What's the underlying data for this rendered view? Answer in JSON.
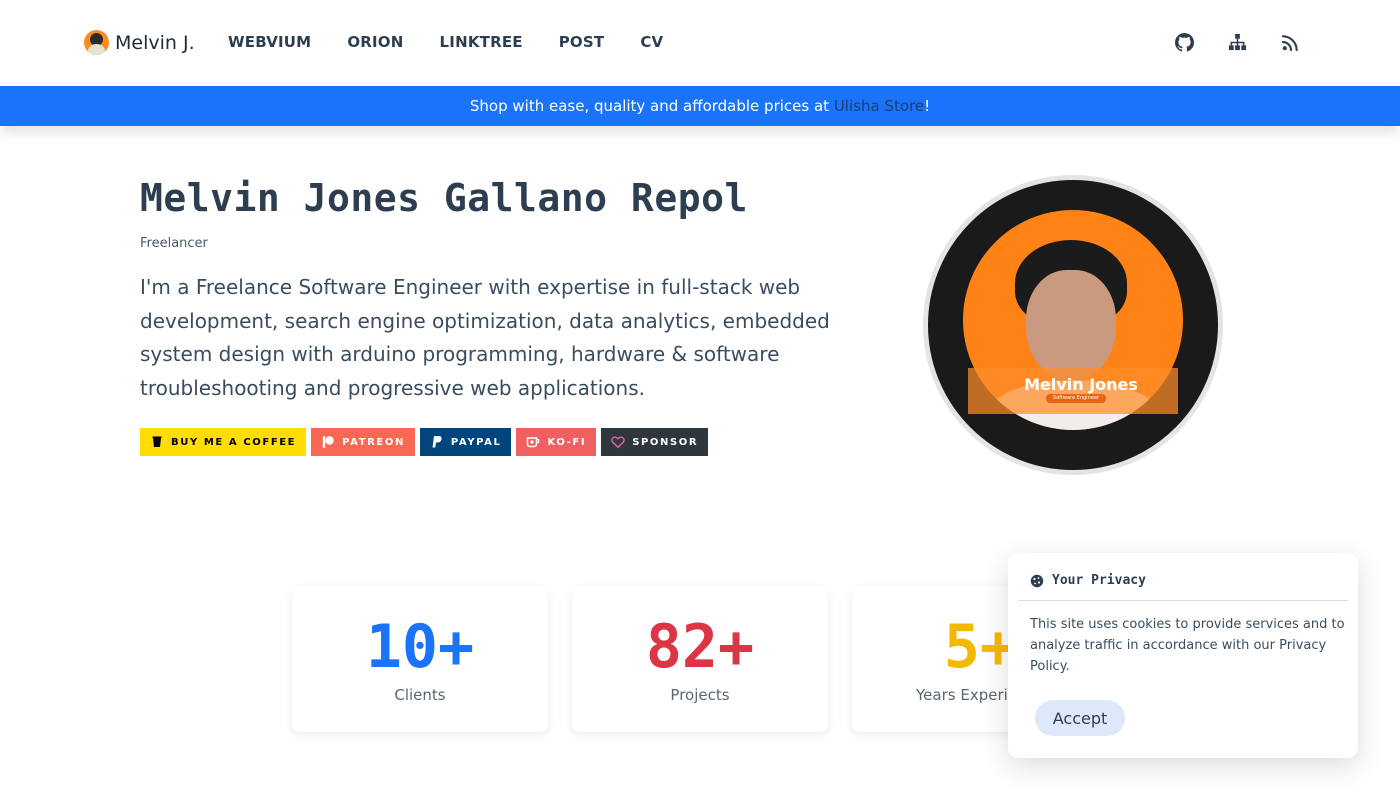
{
  "nav": {
    "brand": "Melvin J.",
    "links": [
      "WEBVIUM",
      "ORION",
      "LINKTREE",
      "POST",
      "CV"
    ],
    "icons": [
      "github-icon",
      "sitemap-icon",
      "rss-icon"
    ]
  },
  "banner": {
    "prefix": "Shop with ease, quality and affordable prices at ",
    "link": "Ulisha Store",
    "suffix": "!"
  },
  "hero": {
    "name": "Melvin Jones Gallano Repol",
    "role": "Freelancer",
    "description": "I'm a Freelance Software Engineer with expertise in full-stack web development, search engine optimization, data analytics, embedded system design with arduino programming, hardware & software troubleshooting and progressive web applications."
  },
  "donate": [
    {
      "label": "BUY ME A COFFEE",
      "icon": "coffee-icon",
      "color": "#ffdd00"
    },
    {
      "label": "PATREON",
      "icon": "patreon-icon",
      "color": "#f96854"
    },
    {
      "label": "PAYPAL",
      "icon": "paypal-icon",
      "color": "#00457c"
    },
    {
      "label": "KO-FI",
      "icon": "kofi-icon",
      "color": "#f16061"
    },
    {
      "label": "SPONSOR",
      "icon": "heart-icon",
      "color": "#30363d"
    }
  ],
  "profile": {
    "name": "Melvin Jones",
    "tag": "Software Engineer"
  },
  "stats": [
    {
      "value": "10+",
      "label": "Clients",
      "color": "#1a73f8"
    },
    {
      "value": "82+",
      "label": "Projects",
      "color": "#dc3545"
    },
    {
      "value": "5+",
      "label": "Years Experience",
      "color": "#f5b800"
    }
  ],
  "privacy": {
    "title": "Your Privacy",
    "text": "This site uses cookies to provide services and to analyze traffic in accordance with our Privacy Policy.",
    "accept": "Accept"
  }
}
